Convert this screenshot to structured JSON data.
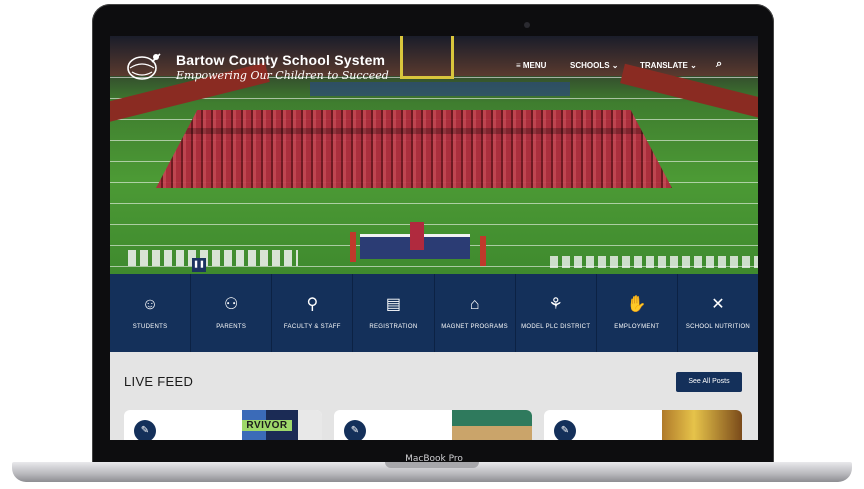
{
  "device": {
    "label": "MacBook Pro"
  },
  "header": {
    "title": "Bartow County School System",
    "tagline": "Empowering Our Children to Succeed",
    "nav": {
      "menu": "≡ MENU",
      "schools": "SCHOOLS ⌄",
      "translate": "TRANSLATE ⌄",
      "search_icon": "⌕"
    }
  },
  "quick_links": [
    {
      "label": "STUDENTS",
      "icon": "student-icon",
      "glyph": "☺"
    },
    {
      "label": "PARENTS",
      "icon": "parents-icon",
      "glyph": "⚇"
    },
    {
      "label": "FACULTY & STAFF",
      "icon": "teacher-icon",
      "glyph": "⚲"
    },
    {
      "label": "REGISTRATION",
      "icon": "clipboard-icon",
      "glyph": "▤"
    },
    {
      "label": "MAGNET PROGRAMS",
      "icon": "magnet-icon",
      "glyph": "⌂"
    },
    {
      "label": "MODEL PLC DISTRICT",
      "icon": "network-icon",
      "glyph": "⚘"
    },
    {
      "label": "EMPLOYMENT",
      "icon": "handshake-icon",
      "glyph": "✋"
    },
    {
      "label": "SCHOOL NUTRITION",
      "icon": "utensils-icon",
      "glyph": "✕"
    }
  ],
  "live_feed": {
    "title": "LIVE FEED",
    "see_all_label": "See All Posts",
    "cards": [
      {
        "image_text": "RVIVOR"
      },
      {
        "image_text": ""
      },
      {
        "image_text": ""
      }
    ]
  },
  "hero": {
    "pause_glyph": "❚❚"
  }
}
